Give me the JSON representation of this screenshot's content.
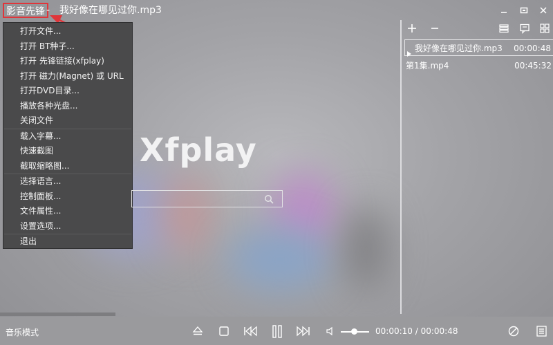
{
  "window": {
    "app_title": "影音先锋",
    "separator": "-",
    "file_title": "我好像在哪见过你.mp3",
    "controls": [
      "minimize-icon",
      "restore-icon",
      "close-icon"
    ]
  },
  "menu": {
    "items": [
      {
        "label": "打开文件..."
      },
      {
        "label": "打开 BT种子..."
      },
      {
        "label": "打开 先锋链接(xfplay)"
      },
      {
        "label": "打开 磁力(Magnet) 或 URL"
      },
      {
        "label": "打开DVD目录..."
      },
      {
        "label": "播放各种光盘..."
      },
      {
        "label": "关闭文件"
      },
      {
        "label": "载入字幕..."
      },
      {
        "label": "快速截图"
      },
      {
        "label": "截取缩略图..."
      },
      {
        "label": "选择语言..."
      },
      {
        "label": "控制面板..."
      },
      {
        "label": "文件属性..."
      },
      {
        "label": "设置选项..."
      },
      {
        "label": "退出"
      }
    ]
  },
  "center": {
    "logo": "Xfplay",
    "search_icon": "search-icon"
  },
  "playlist": {
    "tools": [
      "add-icon",
      "remove-icon",
      "list-icon",
      "chat-icon",
      "grid-icon"
    ],
    "items": [
      {
        "name": "我好像在哪见过你.mp3",
        "duration": "00:00:48",
        "active": true
      },
      {
        "name": "第1集.mp4",
        "duration": "00:45:32",
        "active": false
      }
    ]
  },
  "bottom": {
    "mode_label": "音乐模式",
    "time": "00:00:10 / 00:00:48",
    "volume_level": 0.4,
    "icons": [
      "eject-icon",
      "stop-icon",
      "previous-icon",
      "pause-icon",
      "next-icon",
      "volume-icon",
      "no-video-icon",
      "playlist-toggle-icon"
    ]
  },
  "colors": {
    "highlight": "#e0353a",
    "menu_bg": "#4a4a4b"
  }
}
